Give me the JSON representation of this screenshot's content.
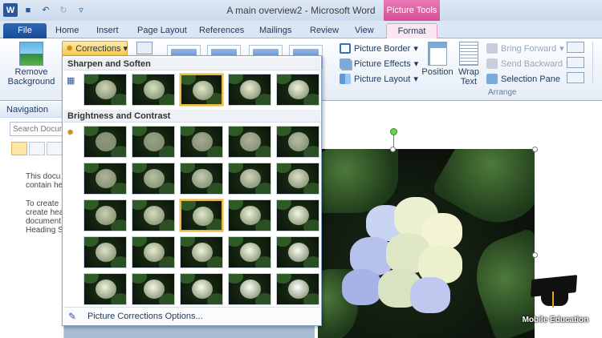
{
  "window": {
    "title": "A main overview2 - Microsoft Word",
    "contextual_tab_group": "Picture Tools"
  },
  "qat": {
    "icons": [
      "word-logo-icon",
      "save-icon",
      "undo-icon",
      "redo-icon",
      "customize-icon"
    ],
    "word_glyph": "W",
    "save_glyph": "■",
    "undo_glyph": "↶",
    "redo_glyph": "↻",
    "customize_glyph": "▿"
  },
  "tabs": [
    "File",
    "Home",
    "Insert",
    "Page Layout",
    "References",
    "Mailings",
    "Review",
    "View",
    "Format"
  ],
  "ribbon": {
    "remove_background": {
      "line1": "Remove",
      "line2": "Background"
    },
    "corrections": "Corrections",
    "picture_border": "Picture Border",
    "picture_effects": "Picture Effects",
    "picture_layout": "Picture Layout",
    "position": "Position",
    "wrap_text": {
      "line1": "Wrap",
      "line2": "Text"
    },
    "bring_forward": "Bring Forward",
    "send_backward": "Send Backward",
    "selection_pane": "Selection Pane",
    "arrange_label": "Arrange",
    "dropdown_glyph": "▾"
  },
  "navigation": {
    "title": "Navigation",
    "search_placeholder": "Search Docum",
    "text_block_1": "This docu\ncontain he",
    "text_block_2": "To create\ncreate hea\ndocument\nHeading S"
  },
  "gallery": {
    "section1_title": "Sharpen and Soften",
    "section2_title": "Brightness and Contrast",
    "footer_label": "Picture Corrections Options...",
    "sharpen_selected_index": 2,
    "brightness_selected": {
      "row": 2,
      "col": 2
    },
    "sharpen_row_colors": [
      "#cfd6b8",
      "#d8dfc2",
      "#e1e8cc",
      "#e8eed4",
      "#eef4dc"
    ],
    "brightness_grid_colors": [
      [
        "#8f9580",
        "#9aa08a",
        "#a4aa94",
        "#aeb49e",
        "#b8bea8"
      ],
      [
        "#aeb49c",
        "#bac0a8",
        "#c5cbb3",
        "#d0d6be",
        "#dbe1c9"
      ],
      [
        "#c9d0b4",
        "#d6dcc1",
        "#e2e8cd",
        "#ecf2d8",
        "#f4f8e2"
      ],
      [
        "#dde3c8",
        "#e6ecd2",
        "#eef3dc",
        "#f4f8e6",
        "#fafcf0"
      ],
      [
        "#eef2dc",
        "#f3f6e4",
        "#f7faec",
        "#fbfdf4",
        "#ffffff"
      ]
    ]
  },
  "watermark": {
    "text": "Mobile Education"
  }
}
